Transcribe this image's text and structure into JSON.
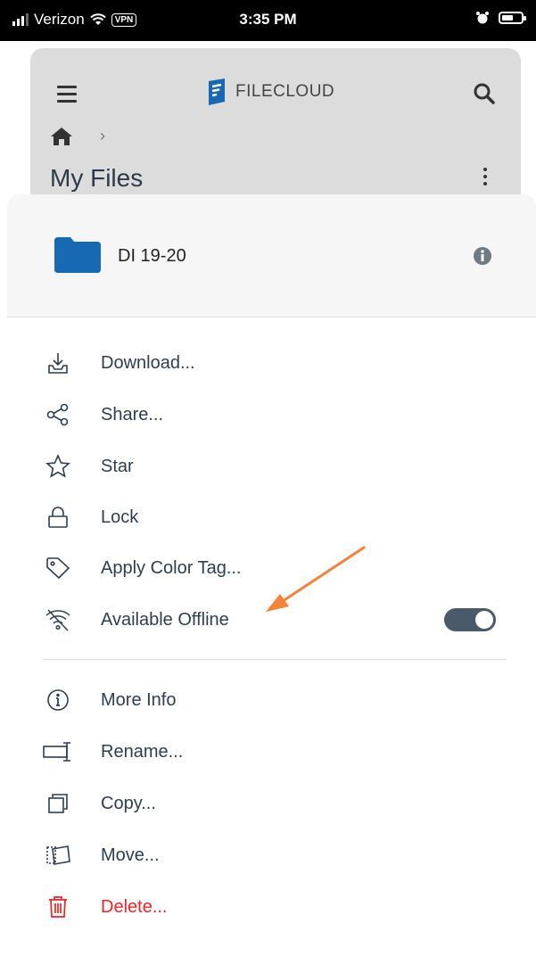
{
  "status_bar": {
    "carrier": "Verizon",
    "vpn": "VPN",
    "time": "3:35 PM"
  },
  "header": {
    "logo_text": "FILECLOUD",
    "title": "My Files"
  },
  "sheet": {
    "folder_name": "DI 19-20",
    "folder_color": "#1769b3",
    "actions": [
      {
        "label": "Download...",
        "icon": "download-icon"
      },
      {
        "label": "Share...",
        "icon": "share-icon"
      },
      {
        "label": "Star",
        "icon": "star-icon"
      },
      {
        "label": "Lock",
        "icon": "lock-icon"
      },
      {
        "label": "Apply Color Tag...",
        "icon": "tag-icon"
      },
      {
        "label": "Available Offline",
        "icon": "offline-icon",
        "toggle_on": true
      }
    ],
    "more_actions": [
      {
        "label": "More Info",
        "icon": "info-icon"
      },
      {
        "label": "Rename...",
        "icon": "rename-icon"
      },
      {
        "label": "Copy...",
        "icon": "copy-icon"
      },
      {
        "label": "Move...",
        "icon": "move-icon"
      },
      {
        "label": "Delete...",
        "icon": "trash-icon",
        "color": "#e8252a"
      }
    ]
  },
  "annotation_color": "#f5823a"
}
